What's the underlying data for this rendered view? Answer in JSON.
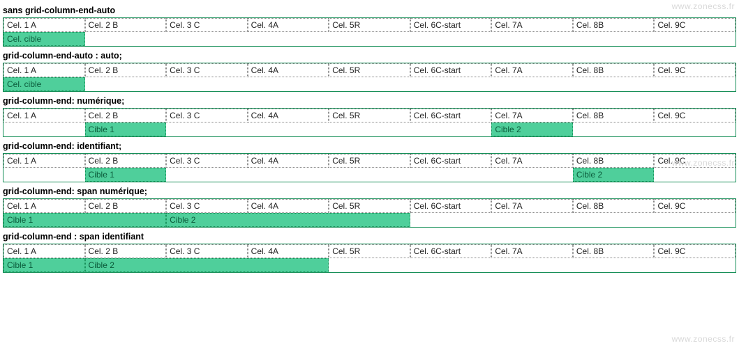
{
  "watermarks": {
    "top": "www.zonecss.fr",
    "mid": "www.zonecss.fr",
    "bottom": "www.zonecss.fr"
  },
  "sections": [
    {
      "title": "sans grid-column-end-auto",
      "row1": [
        "Cel. 1 A",
        "Cel. 2 B",
        "Cel. 3 C",
        "Cel. 4A",
        "Cel. 5R",
        "Cel. 6C-start",
        "Cel. 7A",
        "Cel. 8B",
        "Cel. 9C"
      ],
      "targets": [
        {
          "label": "Cel. cible",
          "col": "1 / 2"
        }
      ]
    },
    {
      "title": "grid-column-end-auto : auto;",
      "row1": [
        "Cel. 1 A",
        "Cel. 2 B",
        "Cel. 3 C",
        "Cel. 4A",
        "Cel. 5R",
        "Cel. 6C-start",
        "Cel. 7A",
        "Cel. 8B",
        "Cel. 9C"
      ],
      "targets": [
        {
          "label": "Cel. cible",
          "col": "1 / 2"
        }
      ]
    },
    {
      "title": "grid-column-end: numérique;",
      "row1": [
        "Cel. 1 A",
        "Cel. 2 B",
        "Cel. 3 C",
        "Cel. 4A",
        "Cel. 5R",
        "Cel. 6C-start",
        "Cel. 7A",
        "Cel. 8B",
        "Cel. 9C"
      ],
      "targets": [
        {
          "label": "Cible 1",
          "col": "2 / 3"
        },
        {
          "label": "Cible 2",
          "col": "7 / 8"
        }
      ]
    },
    {
      "title": "grid-column-end: identifiant;",
      "row1": [
        "Cel. 1 A",
        "Cel. 2 B",
        "Cel. 3 C",
        "Cel. 4A",
        "Cel. 5R",
        "Cel. 6C-start",
        "Cel. 7A",
        "Cel. 8B",
        "Cel. 9C"
      ],
      "targets": [
        {
          "label": "Cible 1",
          "col": "2 / 3"
        },
        {
          "label": "Cible 2",
          "col": "8 / 9"
        }
      ]
    },
    {
      "title": "grid-column-end: span numérique;",
      "row1": [
        "Cel. 1 A",
        "Cel. 2 B",
        "Cel. 3 C",
        "Cel. 4A",
        "Cel. 5R",
        "Cel. 6C-start",
        "Cel. 7A",
        "Cel. 8B",
        "Cel. 9C"
      ],
      "targets": [
        {
          "label": "Cible 1",
          "col": "1 / 3"
        },
        {
          "label": "Cible 2",
          "col": "3 / 6"
        }
      ]
    },
    {
      "title": "grid-column-end : span identifiant",
      "row1": [
        "Cel. 1 A",
        "Cel. 2 B",
        "Cel. 3 C",
        "Cel. 4A",
        "Cel. 5R",
        "Cel. 6C-start",
        "Cel. 7A",
        "Cel. 8B",
        "Cel. 9C"
      ],
      "targets": [
        {
          "label": "Cible 1",
          "col": "1 / 2"
        },
        {
          "label": "Cible 2",
          "col": "2 / 5"
        }
      ]
    }
  ]
}
